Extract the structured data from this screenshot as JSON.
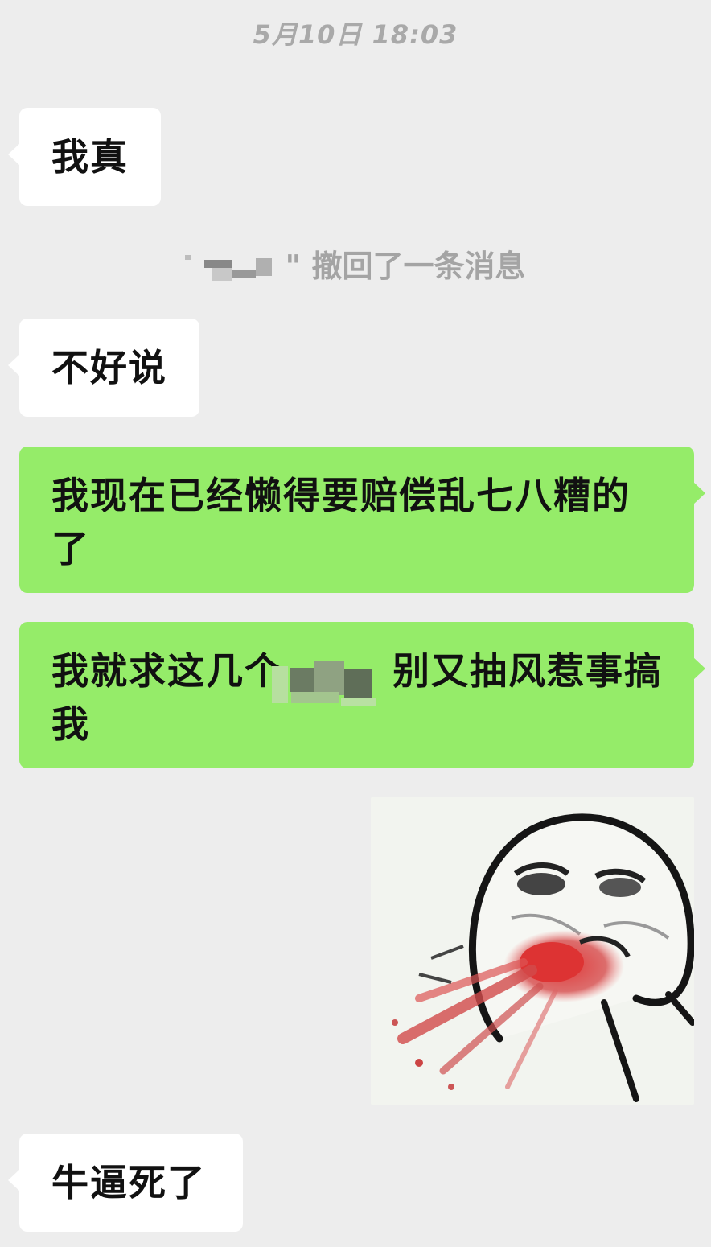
{
  "chat": {
    "timestamp": "5月10日 18:03",
    "recall_notice": "\" 撤回了一条消息",
    "messages": [
      {
        "side": "in",
        "text": "我真"
      },
      {
        "side": "in",
        "text": "不好说"
      },
      {
        "side": "out",
        "line1": "我现在已经懒得要赔偿乱七八糟的",
        "line2": "了"
      },
      {
        "side": "out",
        "line1": "我就求这几个",
        "line1b": "别又抽风惹事搞",
        "line2": "我"
      },
      {
        "side": "out",
        "type": "sticker",
        "sticker": "blood-spitting-meme-face"
      },
      {
        "side": "in",
        "text": "牛逼死了"
      }
    ]
  },
  "colors": {
    "background": "#ededed",
    "incoming_bubble": "#ffffff",
    "outgoing_bubble": "#95ec69",
    "system_text": "#a4a4a4"
  }
}
